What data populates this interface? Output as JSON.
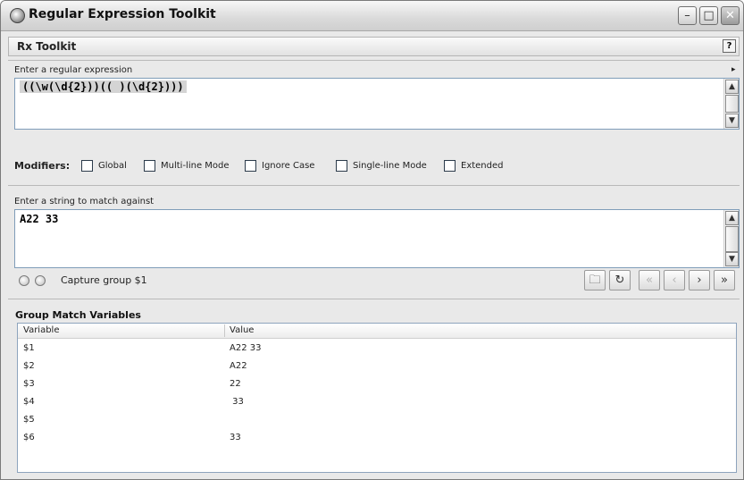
{
  "window": {
    "title": "Regular Expression Toolkit"
  },
  "toolkit": {
    "title": "Rx Toolkit",
    "help": "?"
  },
  "regex": {
    "label": "Enter a regular expression",
    "value": "((\\w(\\d{2}))(( )(\\d{2})))"
  },
  "modifiers": {
    "label": "Modifiers:",
    "options": [
      "Global",
      "Multi-line Mode",
      "Ignore Case",
      "Single-line Mode",
      "Extended"
    ]
  },
  "match": {
    "label": "Enter a string to match against",
    "value": "A22 33"
  },
  "capture": {
    "label": "Capture group $1"
  },
  "toolbar_icons": [
    "folder-open-icon",
    "refresh-icon",
    "first-icon",
    "previous-icon",
    "next-icon",
    "last-icon"
  ],
  "groups": {
    "title": "Group Match Variables",
    "columns": [
      "Variable",
      "Value"
    ],
    "rows": [
      {
        "variable": "$1",
        "value": "A22 33"
      },
      {
        "variable": "$2",
        "value": "A22"
      },
      {
        "variable": "$3",
        "value": "22"
      },
      {
        "variable": "$4",
        "value": " 33"
      },
      {
        "variable": "$5",
        "value": ""
      },
      {
        "variable": "$6",
        "value": "33"
      }
    ]
  },
  "glyphs": {
    "minimize": "–",
    "maximize": "□",
    "close": "✕",
    "scroll_up": "▲",
    "scroll_down": "▼",
    "expand": "▸",
    "folder": "🗀",
    "refresh": "↻",
    "first": "«",
    "prev": "‹",
    "next": "›",
    "last": "»"
  }
}
